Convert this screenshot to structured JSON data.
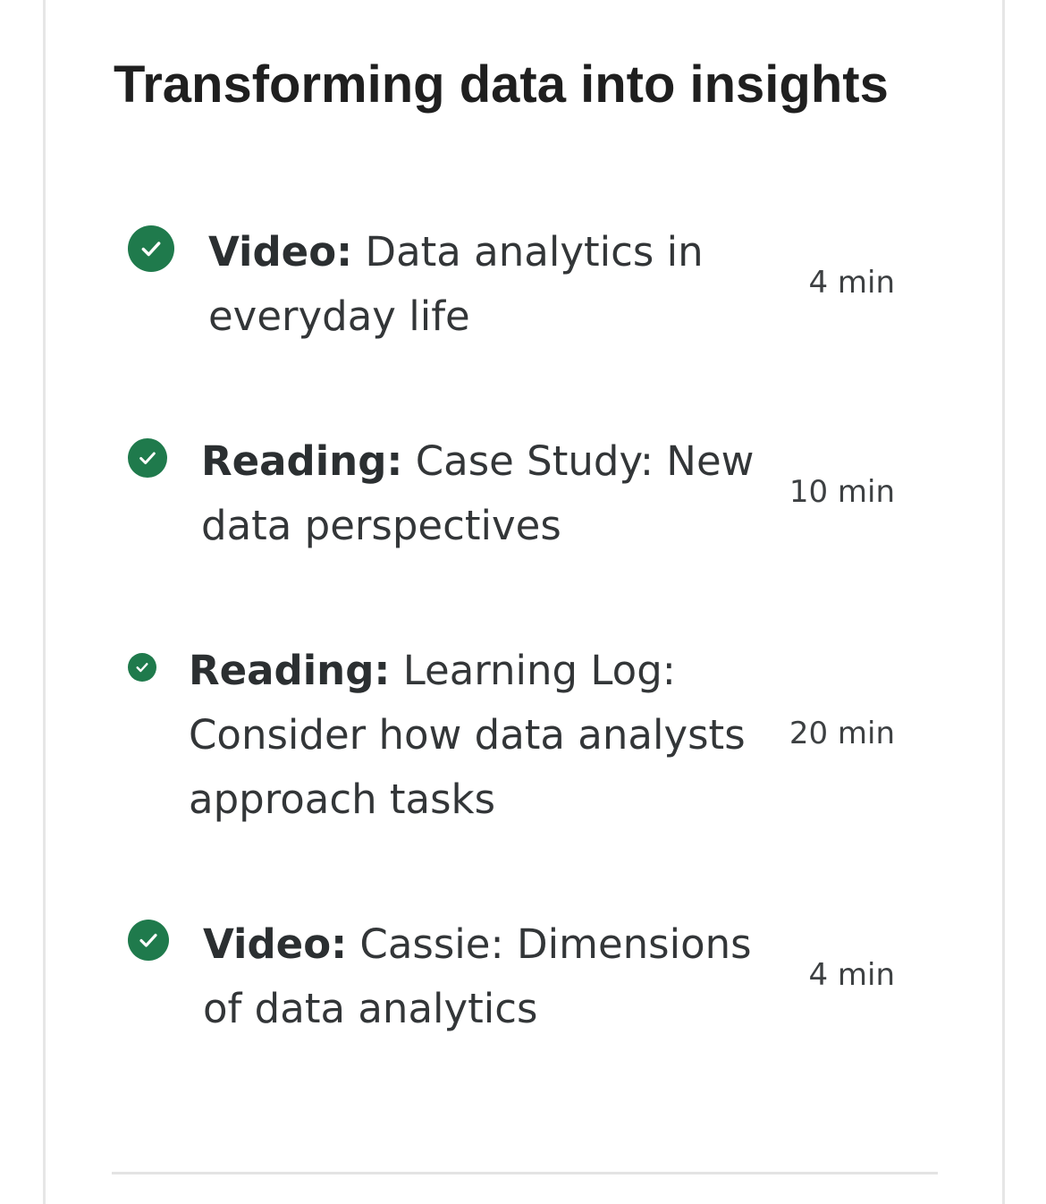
{
  "module": {
    "title": "Transforming data into insights"
  },
  "items": [
    {
      "type": "Video:",
      "title": "Data analytics in everyday life",
      "duration": "4 min",
      "status": "completed",
      "icon": "check-circle-icon"
    },
    {
      "type": "Reading:",
      "title": "Case Study: New data perspectives",
      "duration": "10 min",
      "status": "completed",
      "icon": "check-circle-icon"
    },
    {
      "type": "Reading:",
      "title": "Learning Log: Consider how data analysts approach tasks",
      "duration": "20 min",
      "status": "completed",
      "icon": "check-circle-icon"
    },
    {
      "type": "Video:",
      "title": "Cassie: Dimensions of data analytics",
      "duration": "4 min",
      "status": "completed",
      "icon": "check-circle-icon"
    }
  ],
  "colors": {
    "check": "#1f7a4c",
    "title": "#1f1f1f",
    "text": "#333638",
    "border": "#e6e6e6"
  }
}
